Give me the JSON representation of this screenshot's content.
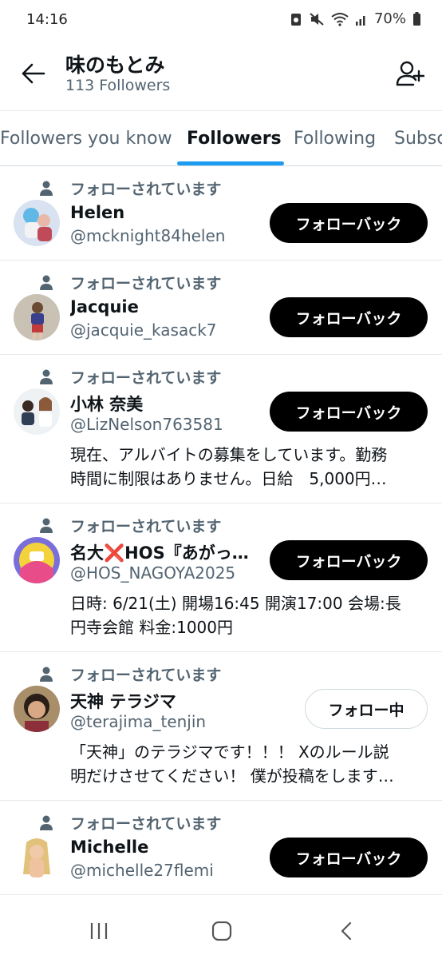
{
  "status_bar": {
    "time": "14:16",
    "battery": "70%"
  },
  "header": {
    "name": "味のもとみ",
    "followers_count": "113 Followers"
  },
  "tabs": [
    {
      "label": "Followers you know"
    },
    {
      "label": "Followers"
    },
    {
      "label": "Following"
    },
    {
      "label": "Subsc"
    }
  ],
  "users": [
    {
      "context": "フォローされています",
      "name": "Helen",
      "handle": "@mcknight84helen",
      "button": "フォローバック",
      "bio": []
    },
    {
      "context": "フォローされています",
      "name": "Jacquie",
      "handle": "@jacquie_kasack7",
      "button": "フォローバック",
      "bio": []
    },
    {
      "context": "フォローされています",
      "name": "小林 奈美",
      "handle": "@LizNelson763581",
      "button": "フォローバック",
      "bio": [
        "現在、アルバイトの募集をしています。勤務",
        "時間に制限はありません。日給　5,000円…"
      ]
    },
    {
      "context": "フォローされています",
      "name": "名大❌HOS『あがっ…",
      "handle": "@HOS_NAGOYA2025",
      "button": "フォローバック",
      "bio": [
        "日時: 6/21(土) 開場16:45 開演17:00 会場:長",
        "円寺会館 料金:1000円"
      ]
    },
    {
      "context": "フォローされています",
      "name": "天神 テラジマ",
      "handle": "@terajima_tenjin",
      "button": "フォロー中",
      "bio": [
        "「天神」のテラジマです！！！ Xのルール説",
        "明だけさせてください！ 僕が投稿をします…"
      ]
    },
    {
      "context": "フォローされています",
      "name": "Michelle",
      "handle": "@michelle27flemi",
      "button": "フォローバック",
      "bio": []
    }
  ],
  "colors": {
    "accent": "#1d9bf0",
    "text_primary": "#0f1419",
    "text_secondary": "#536471",
    "button_dark": "#000000"
  },
  "icons": [
    "back-arrow-icon",
    "add-user-icon",
    "person-icon",
    "recents-icon",
    "home-icon",
    "back-icon"
  ]
}
